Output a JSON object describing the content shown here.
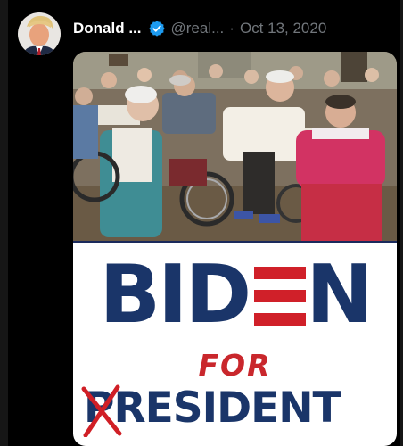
{
  "tweet": {
    "author_name": "Donald ...",
    "author_handle": "@real...",
    "separator": "·",
    "date": "Oct 13, 2020",
    "verified": true
  },
  "poster": {
    "line1_before": "BID",
    "line1_after": "N",
    "line2": "FOR",
    "line3_first": "P",
    "line3_rest": "RESIDENT"
  },
  "colors": {
    "poster_navy": "#1a3569",
    "poster_red": "#c9272c",
    "verified_blue": "#1d9bf0",
    "muted_text": "#71767b"
  }
}
